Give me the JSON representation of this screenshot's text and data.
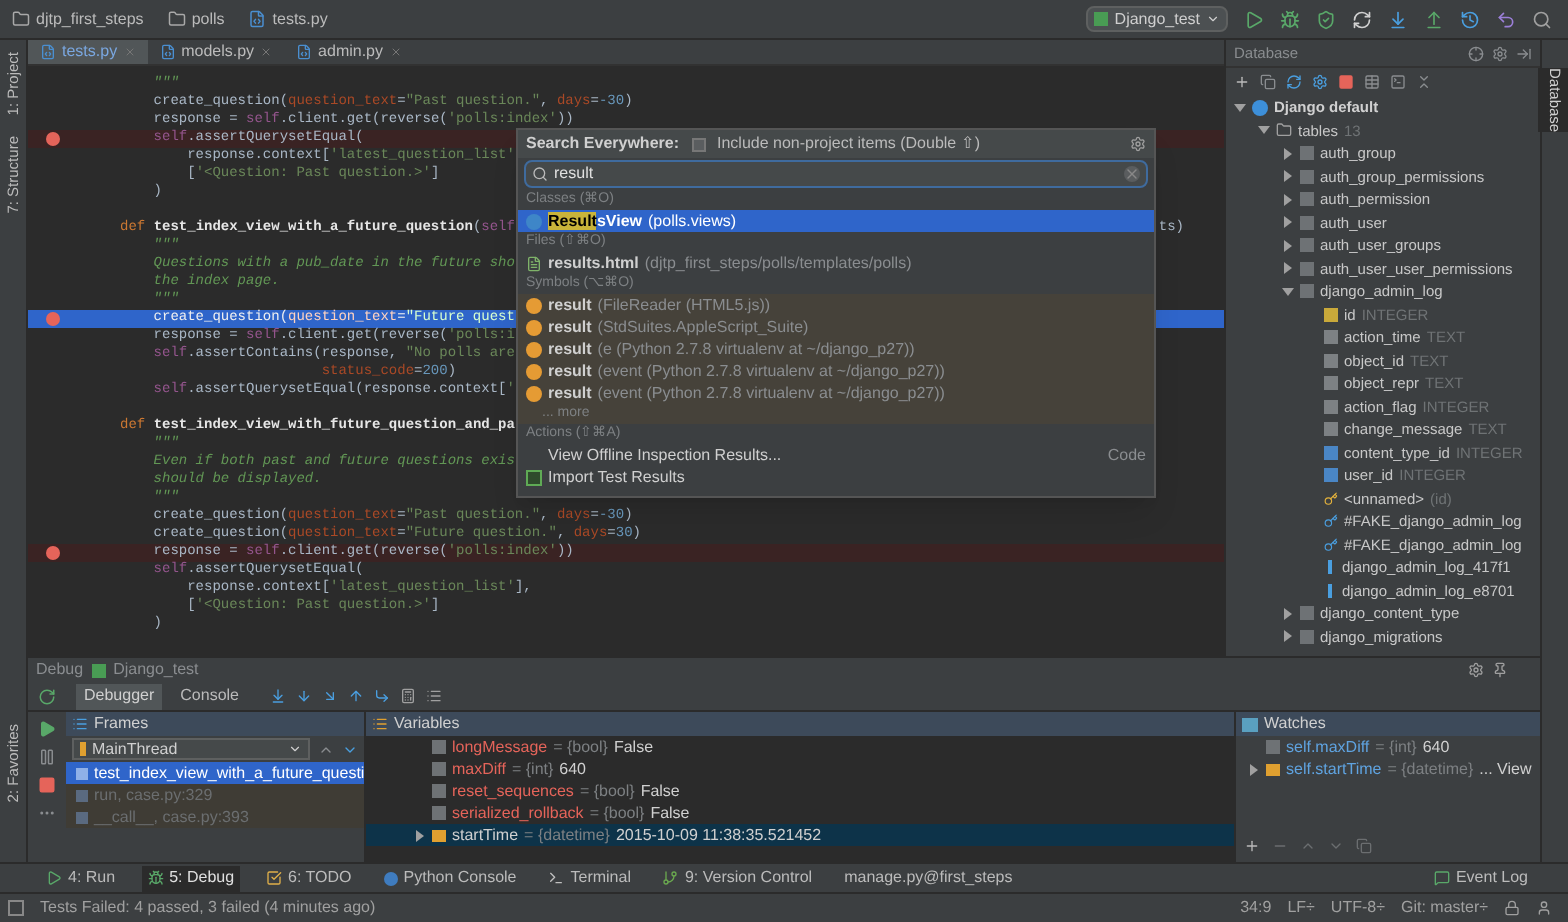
{
  "breadcrumbs": [
    {
      "kind": "folder",
      "label": "djtp_first_steps"
    },
    {
      "kind": "folder",
      "label": "polls"
    },
    {
      "kind": "file",
      "label": "tests.py"
    }
  ],
  "run_config": {
    "label": "Django_test"
  },
  "left_tools": [
    {
      "label": "1: Project"
    },
    {
      "label": "7: Structure"
    }
  ],
  "favorites_tool": {
    "label": "2: Favorites"
  },
  "editor_tabs": [
    {
      "label": "tests.py",
      "selected": true
    },
    {
      "label": "models.py",
      "selected": false
    },
    {
      "label": "admin.py",
      "selected": false
    }
  ],
  "code_lines": [
    {
      "breakpoint": false,
      "current": false,
      "tokens": [
        {
          "kind": "doc",
          "text": "    \"\"\""
        }
      ]
    },
    {
      "breakpoint": false,
      "current": false,
      "tokens": [
        {
          "kind": "plain",
          "text": "    create_question("
        },
        {
          "kind": "param",
          "text": "question_text"
        },
        {
          "kind": "plain",
          "text": "="
        },
        {
          "kind": "str",
          "text": "\"Past question.\""
        },
        {
          "kind": "plain",
          "text": ", "
        },
        {
          "kind": "param",
          "text": "days"
        },
        {
          "kind": "plain",
          "text": "="
        },
        {
          "kind": "num",
          "text": "-30"
        },
        {
          "kind": "plain",
          "text": ")"
        }
      ]
    },
    {
      "breakpoint": false,
      "current": false,
      "tokens": [
        {
          "kind": "plain",
          "text": "    response = "
        },
        {
          "kind": "self",
          "text": "self"
        },
        {
          "kind": "plain",
          "text": ".client.get(reverse("
        },
        {
          "kind": "str",
          "text": "'polls:index'"
        },
        {
          "kind": "plain",
          "text": "))"
        }
      ]
    },
    {
      "breakpoint": true,
      "current": false,
      "tokens": [
        {
          "kind": "self",
          "text": "    self"
        },
        {
          "kind": "plain",
          "text": ".assertQuerysetEqual("
        }
      ]
    },
    {
      "breakpoint": false,
      "current": false,
      "tokens": [
        {
          "kind": "plain",
          "text": "        response.context["
        },
        {
          "kind": "str",
          "text": "'latest_question_list'"
        }
      ]
    },
    {
      "breakpoint": false,
      "current": false,
      "tokens": [
        {
          "kind": "plain",
          "text": "        ["
        },
        {
          "kind": "str",
          "text": "'<Question: Past question.>'"
        },
        {
          "kind": "plain",
          "text": "]"
        }
      ]
    },
    {
      "breakpoint": false,
      "current": false,
      "tokens": [
        {
          "kind": "plain",
          "text": "    )"
        }
      ]
    },
    {
      "breakpoint": false,
      "current": false
    },
    {
      "breakpoint": false,
      "current": false,
      "tokens": [
        {
          "kind": "kw",
          "text": "def "
        },
        {
          "kind": "fn",
          "text": "test_index_view_with_a_future_question"
        },
        {
          "kind": "plain",
          "text": "("
        },
        {
          "kind": "self",
          "text": "self"
        }
      ],
      "tail": "ts)"
    },
    {
      "breakpoint": false,
      "current": false,
      "tokens": [
        {
          "kind": "doc",
          "text": "    \"\"\""
        }
      ]
    },
    {
      "breakpoint": false,
      "current": false,
      "tokens": [
        {
          "kind": "doc",
          "text": "    Questions with a pub_date in the future sho"
        }
      ]
    },
    {
      "breakpoint": false,
      "current": false,
      "tokens": [
        {
          "kind": "doc",
          "text": "    the index page."
        }
      ]
    },
    {
      "breakpoint": false,
      "current": false,
      "tokens": [
        {
          "kind": "doc",
          "text": "    \"\"\""
        }
      ]
    },
    {
      "breakpoint": true,
      "current": true,
      "tokens": [
        {
          "kind": "plain",
          "text": "    create_question("
        },
        {
          "kind": "param",
          "text": "question_text"
        },
        {
          "kind": "plain",
          "text": "="
        },
        {
          "kind": "str",
          "text": "\"Future quest"
        }
      ]
    },
    {
      "breakpoint": false,
      "current": false,
      "tokens": [
        {
          "kind": "plain",
          "text": "    response = "
        },
        {
          "kind": "self",
          "text": "self"
        },
        {
          "kind": "plain",
          "text": ".client.get(reverse("
        },
        {
          "kind": "str",
          "text": "'polls:i"
        }
      ]
    },
    {
      "breakpoint": false,
      "current": false,
      "tokens": [
        {
          "kind": "self",
          "text": "    self"
        },
        {
          "kind": "plain",
          "text": ".assertContains(response, "
        },
        {
          "kind": "str",
          "text": "\"No polls are"
        }
      ]
    },
    {
      "breakpoint": false,
      "current": false,
      "tokens": [
        {
          "kind": "param",
          "text": "                        status_code"
        },
        {
          "kind": "plain",
          "text": "="
        },
        {
          "kind": "num",
          "text": "200"
        },
        {
          "kind": "plain",
          "text": ")"
        }
      ]
    },
    {
      "breakpoint": false,
      "current": false,
      "tokens": [
        {
          "kind": "self",
          "text": "    self"
        },
        {
          "kind": "plain",
          "text": ".assertQuerysetEqual(response.context["
        },
        {
          "kind": "str",
          "text": "'"
        }
      ]
    },
    {
      "breakpoint": false,
      "current": false
    },
    {
      "breakpoint": false,
      "current": false,
      "tokens": [
        {
          "kind": "kw",
          "text": "def "
        },
        {
          "kind": "fn",
          "text": "test_index_view_with_future_question_and_pa"
        }
      ]
    },
    {
      "breakpoint": false,
      "current": false,
      "tokens": [
        {
          "kind": "doc",
          "text": "    \"\"\""
        }
      ]
    },
    {
      "breakpoint": false,
      "current": false,
      "tokens": [
        {
          "kind": "doc",
          "text": "    Even if both past and future questions exis"
        }
      ]
    },
    {
      "breakpoint": false,
      "current": false,
      "tokens": [
        {
          "kind": "doc",
          "text": "    should be displayed."
        }
      ]
    },
    {
      "breakpoint": false,
      "current": false,
      "tokens": [
        {
          "kind": "doc",
          "text": "    \"\"\""
        }
      ]
    },
    {
      "breakpoint": false,
      "current": false,
      "tokens": [
        {
          "kind": "plain",
          "text": "    create_question("
        },
        {
          "kind": "param",
          "text": "question_text"
        },
        {
          "kind": "plain",
          "text": "="
        },
        {
          "kind": "str",
          "text": "\"Past question.\""
        },
        {
          "kind": "plain",
          "text": ", "
        },
        {
          "kind": "param",
          "text": "days"
        },
        {
          "kind": "plain",
          "text": "="
        },
        {
          "kind": "num",
          "text": "-30"
        },
        {
          "kind": "plain",
          "text": ")"
        }
      ]
    },
    {
      "breakpoint": false,
      "current": false,
      "tokens": [
        {
          "kind": "plain",
          "text": "    create_question("
        },
        {
          "kind": "param",
          "text": "question_text"
        },
        {
          "kind": "plain",
          "text": "="
        },
        {
          "kind": "str",
          "text": "\"Future question.\""
        },
        {
          "kind": "plain",
          "text": ", "
        },
        {
          "kind": "param",
          "text": "days"
        },
        {
          "kind": "plain",
          "text": "="
        },
        {
          "kind": "num",
          "text": "30"
        },
        {
          "kind": "plain",
          "text": ")"
        }
      ]
    },
    {
      "breakpoint": true,
      "current": false,
      "tokens": [
        {
          "kind": "plain",
          "text": "    response = "
        },
        {
          "kind": "self",
          "text": "self"
        },
        {
          "kind": "plain",
          "text": ".client.get(reverse("
        },
        {
          "kind": "str",
          "text": "'polls:index'"
        },
        {
          "kind": "plain",
          "text": "))"
        }
      ]
    },
    {
      "breakpoint": false,
      "current": false,
      "tokens": [
        {
          "kind": "self",
          "text": "    self"
        },
        {
          "kind": "plain",
          "text": ".assertQuerysetEqual("
        }
      ]
    },
    {
      "breakpoint": false,
      "current": false,
      "tokens": [
        {
          "kind": "plain",
          "text": "        response.context["
        },
        {
          "kind": "str",
          "text": "'latest_question_list'"
        },
        {
          "kind": "plain",
          "text": "],"
        }
      ]
    },
    {
      "breakpoint": false,
      "current": false,
      "tokens": [
        {
          "kind": "plain",
          "text": "        ["
        },
        {
          "kind": "str",
          "text": "'<Question: Past question.>'"
        },
        {
          "kind": "plain",
          "text": "]"
        }
      ]
    },
    {
      "breakpoint": false,
      "current": false,
      "tokens": [
        {
          "kind": "plain",
          "text": "    )"
        }
      ]
    }
  ],
  "search_popup": {
    "title": "Search Everywhere:",
    "include_non_project": {
      "label": "Include non-project items (Double ⇧)",
      "checked": false
    },
    "query": "result",
    "sections": [
      {
        "label": "Classes (⌘O)",
        "items": [
          {
            "kind": "class",
            "match": "Result",
            "name": "sView",
            "detail": "(polls.views)",
            "selected": true
          }
        ]
      },
      {
        "label": "Files (⇧⌘O)",
        "items": [
          {
            "kind": "file",
            "name": "results.html",
            "detail": "(djtp_first_steps/polls/templates/polls)",
            "selected": false
          }
        ]
      },
      {
        "label": "Symbols (⌥⌘O)",
        "items": [
          {
            "kind": "symbol",
            "name": "result",
            "detail": "(FileReader (HTML5.js))",
            "selected": false
          },
          {
            "kind": "symbol",
            "name": "result",
            "detail": "(StdSuites.AppleScript_Suite)",
            "selected": false
          },
          {
            "kind": "symbol",
            "name": "result",
            "detail": "(e (Python 2.7.8 virtualenv at ~/django_p27))",
            "selected": false
          },
          {
            "kind": "symbol",
            "name": "result",
            "detail": "(event (Python 2.7.8 virtualenv at ~/django_p27))",
            "selected": false
          },
          {
            "kind": "symbol",
            "name": "result",
            "detail": "(event (Python 2.7.8 virtualenv at ~/django_p27))",
            "selected": false
          }
        ],
        "more": "... more"
      },
      {
        "label": "Actions (⇧⌘A)",
        "items": [
          {
            "kind": "action",
            "name": "View Offline Inspection Results...",
            "group": "Code",
            "selected": false
          },
          {
            "kind": "import",
            "name": "Import Test Results",
            "selected": false
          }
        ]
      }
    ]
  },
  "database": {
    "title": "Database",
    "tree": [
      {
        "kind": "datasource",
        "name": "Django default",
        "expanded": true,
        "children": [
          {
            "kind": "folder",
            "name": "tables",
            "count": "13",
            "expanded": true,
            "children": [
              {
                "kind": "table",
                "name": "auth_group",
                "expanded": false
              },
              {
                "kind": "table",
                "name": "auth_group_permissions",
                "expanded": false
              },
              {
                "kind": "table",
                "name": "auth_permission",
                "expanded": false
              },
              {
                "kind": "table",
                "name": "auth_user",
                "expanded": false
              },
              {
                "kind": "table",
                "name": "auth_user_groups",
                "expanded": false
              },
              {
                "kind": "table",
                "name": "auth_user_user_permissions",
                "expanded": false
              },
              {
                "kind": "table",
                "name": "django_admin_log",
                "expanded": true,
                "children": [
                  {
                    "kind": "pk",
                    "name": "id",
                    "type": "INTEGER"
                  },
                  {
                    "kind": "column",
                    "name": "action_time",
                    "type": "TEXT"
                  },
                  {
                    "kind": "column",
                    "name": "object_id",
                    "type": "TEXT"
                  },
                  {
                    "kind": "column",
                    "name": "object_repr",
                    "type": "TEXT"
                  },
                  {
                    "kind": "column",
                    "name": "action_flag",
                    "type": "INTEGER"
                  },
                  {
                    "kind": "column",
                    "name": "change_message",
                    "type": "TEXT"
                  },
                  {
                    "kind": "fk",
                    "name": "content_type_id",
                    "type": "INTEGER"
                  },
                  {
                    "kind": "fk",
                    "name": "user_id",
                    "type": "INTEGER"
                  },
                  {
                    "kind": "key",
                    "name": "<unnamed>",
                    "type": "(id)"
                  },
                  {
                    "kind": "fkey",
                    "name": "#FAKE_django_admin_log"
                  },
                  {
                    "kind": "fkey",
                    "name": "#FAKE_django_admin_log"
                  },
                  {
                    "kind": "index",
                    "name": "django_admin_log_417f1"
                  },
                  {
                    "kind": "index",
                    "name": "django_admin_log_e8701"
                  }
                ]
              },
              {
                "kind": "table",
                "name": "django_content_type",
                "expanded": false
              },
              {
                "kind": "table",
                "name": "django_migrations",
                "expanded": false
              }
            ]
          }
        ]
      }
    ]
  },
  "right_tools": [
    {
      "label": "Database",
      "selected": true
    }
  ],
  "debug": {
    "title": "Debug",
    "session": "Django_test",
    "tabs": [
      {
        "label": "Debugger",
        "selected": true
      },
      {
        "label": "Console",
        "selected": false
      }
    ],
    "frames": {
      "title": "Frames",
      "thread": "MainThread",
      "items": [
        {
          "label": "test_index_view_with_a_future_questi",
          "selected": true,
          "library": false
        },
        {
          "label": "run, case.py:329",
          "selected": false,
          "library": true
        },
        {
          "label": "__call__, case.py:393",
          "selected": false,
          "library": true
        }
      ]
    },
    "variables": {
      "title": "Variables",
      "items": [
        {
          "name": "longMessage",
          "type": "= {bool}",
          "value": "False",
          "expandable": false,
          "selected": false
        },
        {
          "name": "maxDiff",
          "type": "= {int}",
          "value": "640",
          "expandable": false,
          "selected": false
        },
        {
          "name": "reset_sequences",
          "type": "= {bool}",
          "value": "False",
          "expandable": false,
          "selected": false
        },
        {
          "name": "serialized_rollback",
          "type": "= {bool}",
          "value": "False",
          "expandable": false,
          "selected": false
        },
        {
          "name": "startTime",
          "type": "= {datetime}",
          "value": "2015-10-09 11:38:35.521452",
          "expandable": true,
          "selected": true
        }
      ]
    },
    "watches": {
      "title": "Watches",
      "items": [
        {
          "name": "self.maxDiff",
          "type": "= {int}",
          "value": "640",
          "expandable": false
        },
        {
          "name": "self.startTime",
          "type": "= {datetime}",
          "value": "... View",
          "expandable": true
        }
      ]
    }
  },
  "tool_buttons": [
    {
      "kind": "run",
      "label": "4: Run",
      "selected": false
    },
    {
      "kind": "debug",
      "label": "5: Debug",
      "selected": true
    },
    {
      "kind": "todo",
      "label": "6: TODO",
      "selected": false
    },
    {
      "kind": "python",
      "label": "Python Console",
      "selected": false
    },
    {
      "kind": "terminal",
      "label": "Terminal",
      "selected": false
    },
    {
      "kind": "vcs",
      "label": "9: Version Control",
      "selected": false
    },
    {
      "kind": "manage",
      "label": "manage.py@first_steps",
      "selected": false
    }
  ],
  "event_log": {
    "label": "Event Log"
  },
  "status_bar": {
    "message": "Tests Failed: 4 passed, 3 failed (4 minutes ago)",
    "items": [
      "34:9",
      "LF÷",
      "UTF-8÷",
      "Git: master÷"
    ]
  }
}
